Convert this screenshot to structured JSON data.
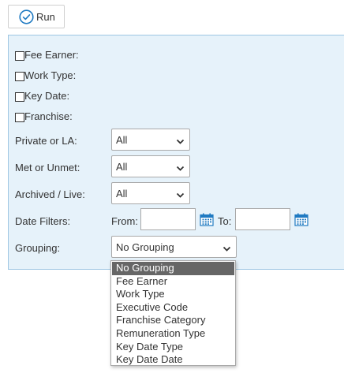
{
  "toolbar": {
    "run_label": "Run"
  },
  "filters": {
    "checkboxes": [
      {
        "label": "Fee Earner:"
      },
      {
        "label": "Work Type:"
      },
      {
        "label": "Key Date:"
      },
      {
        "label": "Franchise:"
      }
    ],
    "private_or_la": {
      "label": "Private or LA:",
      "value": "All"
    },
    "met_or_unmet": {
      "label": "Met or Unmet:",
      "value": "All"
    },
    "archived_live": {
      "label": "Archived / Live:",
      "value": "All"
    },
    "date_filters": {
      "label": "Date Filters:",
      "from_label": "From:",
      "to_label": "To:",
      "from_value": "",
      "to_value": ""
    },
    "grouping": {
      "label": "Grouping:",
      "value": "No Grouping",
      "options": [
        "No Grouping",
        "Fee Earner",
        "Work Type",
        "Executive Code",
        "Franchise Category",
        "Remuneration Type",
        "Key Date Type",
        "Key Date Date"
      ],
      "selected_index": 0
    }
  },
  "colors": {
    "panel_bg": "#e6f2fa",
    "panel_border": "#9ec6e3",
    "accent": "#1f7ac2",
    "selected_option_bg": "#666666"
  },
  "icons": {
    "run": "check-circle-icon",
    "calendar": "calendar-icon",
    "chevron": "chevron-down-icon"
  }
}
